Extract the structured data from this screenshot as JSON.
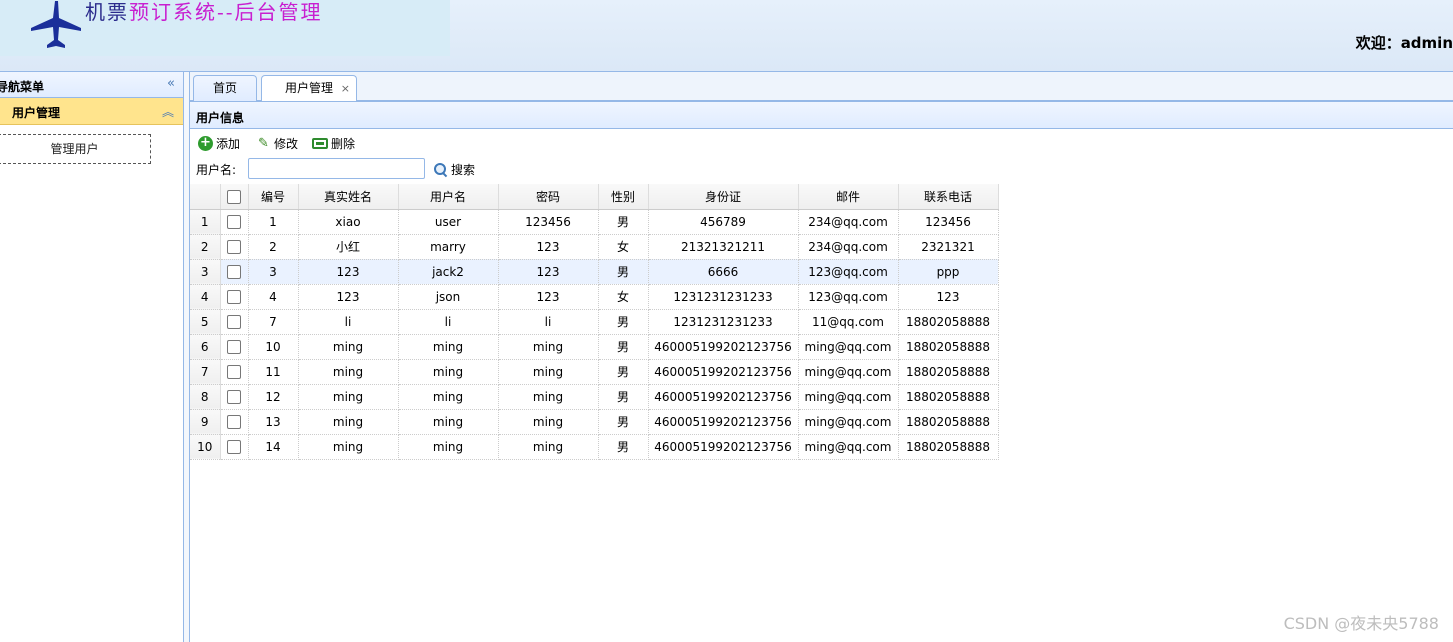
{
  "header": {
    "title_part1": "机票",
    "title_part2": "预订系统--后台管理",
    "welcome": "欢迎：admin"
  },
  "nav": {
    "title": "导航菜单",
    "group_label": "用户管理",
    "menu_item": "管理用户"
  },
  "tabs": [
    {
      "label": "首页"
    },
    {
      "label": "用户管理",
      "close": "×"
    }
  ],
  "panel": {
    "title": "用户信息",
    "toolbar": {
      "add": "添加",
      "edit": "修改",
      "delete": "删除"
    },
    "search": {
      "label": "用户名:",
      "value": "",
      "button": "搜索"
    }
  },
  "grid": {
    "columns": [
      "编号",
      "真实姓名",
      "用户名",
      "密码",
      "性别",
      "身份证",
      "邮件",
      "联系电话"
    ],
    "rows": [
      {
        "rn": "1",
        "id": "1",
        "name": "xiao",
        "username": "user",
        "password": "123456",
        "gender": "男",
        "idcard": "456789",
        "email": "234@qq.com",
        "phone": "123456"
      },
      {
        "rn": "2",
        "id": "2",
        "name": "小红",
        "username": "marry",
        "password": "123",
        "gender": "女",
        "idcard": "21321321211",
        "email": "234@qq.com",
        "phone": "2321321"
      },
      {
        "rn": "3",
        "id": "3",
        "name": "123",
        "username": "jack2",
        "password": "123",
        "gender": "男",
        "idcard": "6666",
        "email": "123@qq.com",
        "phone": "ppp"
      },
      {
        "rn": "4",
        "id": "4",
        "name": "123",
        "username": "json",
        "password": "123",
        "gender": "女",
        "idcard": "1231231231233",
        "email": "123@qq.com",
        "phone": "123"
      },
      {
        "rn": "5",
        "id": "7",
        "name": "li",
        "username": "li",
        "password": "li",
        "gender": "男",
        "idcard": "1231231231233",
        "email": "11@qq.com",
        "phone": "18802058888"
      },
      {
        "rn": "6",
        "id": "10",
        "name": "ming",
        "username": "ming",
        "password": "ming",
        "gender": "男",
        "idcard": "460005199202123756",
        "email": "ming@qq.com",
        "phone": "18802058888"
      },
      {
        "rn": "7",
        "id": "11",
        "name": "ming",
        "username": "ming",
        "password": "ming",
        "gender": "男",
        "idcard": "460005199202123756",
        "email": "ming@qq.com",
        "phone": "18802058888"
      },
      {
        "rn": "8",
        "id": "12",
        "name": "ming",
        "username": "ming",
        "password": "ming",
        "gender": "男",
        "idcard": "460005199202123756",
        "email": "ming@qq.com",
        "phone": "18802058888"
      },
      {
        "rn": "9",
        "id": "13",
        "name": "ming",
        "username": "ming",
        "password": "ming",
        "gender": "男",
        "idcard": "460005199202123756",
        "email": "ming@qq.com",
        "phone": "18802058888"
      },
      {
        "rn": "10",
        "id": "14",
        "name": "ming",
        "username": "ming",
        "password": "ming",
        "gender": "男",
        "idcard": "460005199202123756",
        "email": "ming@qq.com",
        "phone": "18802058888"
      }
    ],
    "selected_row": 3
  },
  "watermark": "CSDN @夜未央5788",
  "colors": {
    "accent_border": "#95b8e7",
    "menu_group_bg": "#ffe48d",
    "title_color": "#c81fd0"
  },
  "icons": [
    "airplane-icon",
    "collapse-left-icon",
    "collapse-up-icon",
    "add-icon",
    "edit-icon",
    "delete-icon",
    "search-icon"
  ]
}
